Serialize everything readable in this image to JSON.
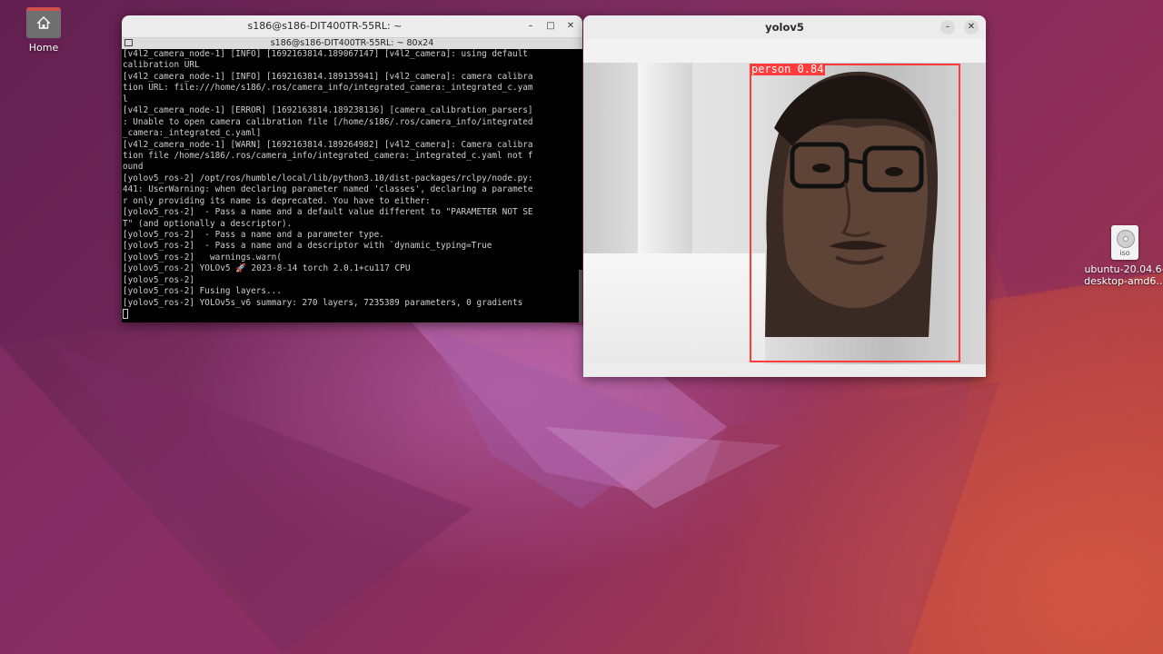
{
  "desktop": {
    "home_label": "Home",
    "iso_name_line1": "ubuntu-20.04.6-",
    "iso_name_line2": "desktop-amd6...",
    "iso_badge": "iso"
  },
  "terminal": {
    "title": "s186@s186-DIT400TR-55RL: ~",
    "subtitle": "s186@s186-DIT400TR-55RL: ~ 80x24",
    "lines": [
      "[v4l2_camera_node-1] [INFO] [1692163814.189067147] [v4l2_camera]: using default",
      "calibration URL",
      "[v4l2_camera_node-1] [INFO] [1692163814.189135941] [v4l2_camera]: camera calibra",
      "tion URL: file:///home/s186/.ros/camera_info/integrated_camera:_integrated_c.yam",
      "l",
      "[v4l2_camera_node-1] [ERROR] [1692163814.189238136] [camera_calibration_parsers]",
      ": Unable to open camera calibration file [/home/s186/.ros/camera_info/integrated",
      "_camera:_integrated_c.yaml]",
      "[v4l2_camera_node-1] [WARN] [1692163814.189264982] [v4l2_camera]: Camera calibra",
      "tion file /home/s186/.ros/camera_info/integrated_camera:_integrated_c.yaml not f",
      "ound",
      "[yolov5_ros-2] /opt/ros/humble/local/lib/python3.10/dist-packages/rclpy/node.py:",
      "441: UserWarning: when declaring parameter named 'classes', declaring a paramete",
      "r only providing its name is deprecated. You have to either:",
      "[yolov5_ros-2]  - Pass a name and a default value different to \"PARAMETER NOT SE",
      "T\" (and optionally a descriptor).",
      "[yolov5_ros-2]  - Pass a name and a parameter type.",
      "[yolov5_ros-2]  - Pass a name and a descriptor with `dynamic_typing=True",
      "[yolov5_ros-2]   warnings.warn(",
      "[yolov5_ros-2] YOLOv5 🚀 2023-8-14 torch 2.0.1+cu117 CPU",
      "[yolov5_ros-2]",
      "[yolov5_ros-2] Fusing layers...",
      "[yolov5_ros-2] YOLOv5s_v6 summary: 270 layers, 7235389 parameters, 0 gradients"
    ]
  },
  "yolo": {
    "title": "yolov5",
    "detection_label": "person 0.84",
    "detection_confidence": 0.84,
    "box_color": "#ff3b3b"
  },
  "window_buttons": {
    "minimize": "–",
    "maximize": "□",
    "close": "✕"
  }
}
